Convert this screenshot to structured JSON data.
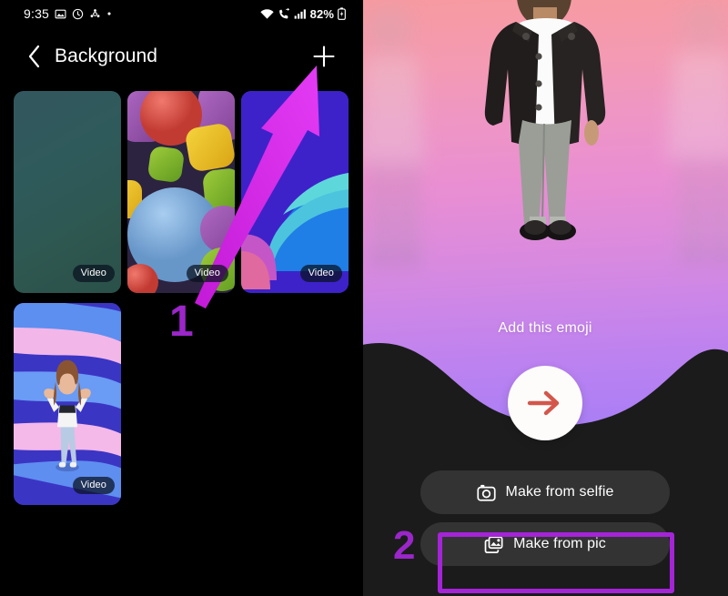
{
  "left_phone": {
    "status_bar": {
      "time": "9:35",
      "battery_text": "82%",
      "left_icons": [
        "photo-icon",
        "clock-icon",
        "settings-gear-icon",
        "dot-icon"
      ],
      "right_icons": [
        "wifi-icon",
        "call-forward-icon",
        "signal-bars-icon",
        "battery-icon"
      ]
    },
    "title_bar": {
      "back_label": "back-chevron",
      "title": "Background",
      "add_label": "+"
    },
    "thumbnails": [
      {
        "name": "teal-gradient",
        "badge": "Video"
      },
      {
        "name": "3d-shapes",
        "badge": "Video"
      },
      {
        "name": "blue-abstract",
        "badge": "Video"
      },
      {
        "name": "avatar-swirl",
        "badge": "Video"
      }
    ],
    "annotation": {
      "step": "1"
    }
  },
  "right_phone": {
    "emoji_preview": {
      "caption": "Add this emoji",
      "next_icon": "arrow-right-icon"
    },
    "actions": [
      {
        "icon": "camera-icon",
        "label": "Make from selfie"
      },
      {
        "icon": "picture-icon",
        "label": "Make from pic"
      }
    ],
    "annotation": {
      "step": "2"
    }
  },
  "colors": {
    "annotation_purple": "#9B26C9",
    "highlight_purple": "#A524D8",
    "arrow_magenta": "#D81AE6",
    "fab_arrow_red": "#D4564B",
    "button_bg": "#333333",
    "panel_black": "#000000"
  }
}
